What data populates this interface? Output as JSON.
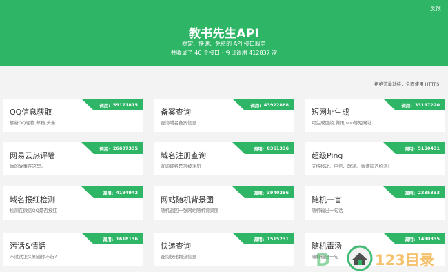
{
  "header": {
    "feedback_label": "反馈",
    "title": "教书先生API",
    "subtitle": "稳定、快速、免费的 API 接口服务",
    "stats": "共收录了 46 个接口 · 今日调用 412837 次",
    "background_color": "#2eb566"
  },
  "notice": "拒绝流量劫持，全面使用 HTTPS!",
  "apis": [
    {
      "name": "QQ信息获取",
      "desc": "解析QQ昵称,邮箱,头像",
      "calls_label": "调用:",
      "calls": "59171815"
    },
    {
      "name": "备案查询",
      "desc": "查询域名备案信息",
      "calls_label": "调用:",
      "calls": "43922868"
    },
    {
      "name": "短网址生成",
      "desc": "可生成度娘,腾讯,suo等短网址",
      "calls_label": "调用:",
      "calls": "33197220"
    },
    {
      "name": "网易云热评墙",
      "desc": "你的故事在这里。",
      "calls_label": "调用:",
      "calls": "26607335"
    },
    {
      "name": "域名注册查询",
      "desc": "查询域名是否被注册",
      "calls_label": "调用:",
      "calls": "8361336"
    },
    {
      "name": "超级Ping",
      "desc": "支持移动、电信、联通、香港延迟检测!",
      "calls_label": "调用:",
      "calls": "5150431"
    },
    {
      "name": "域名报红检测",
      "desc": "检测在微信QQ是否报红",
      "calls_label": "调用:",
      "calls": "4194942"
    },
    {
      "name": "网站随机背景图",
      "desc": "随机返回一张网站随机背景图",
      "calls_label": "调用:",
      "calls": "3940256"
    },
    {
      "name": "随机一言",
      "desc": "随机输出一句话",
      "calls_label": "调用:",
      "calls": "2335333"
    },
    {
      "name": "污话&情话",
      "desc": "不试试怎么知道你不行?",
      "calls_label": "调用:",
      "calls": "1618136"
    },
    {
      "name": "快递查询",
      "desc": "查询快递物流信息",
      "calls_label": "调用:",
      "calls": "1515231"
    },
    {
      "name": "随机毒汤",
      "desc": "随机输出一句",
      "calls_label": "调用:",
      "calls": "1490335"
    }
  ],
  "watermark": {
    "text": "123目录",
    "prefix": "D"
  }
}
